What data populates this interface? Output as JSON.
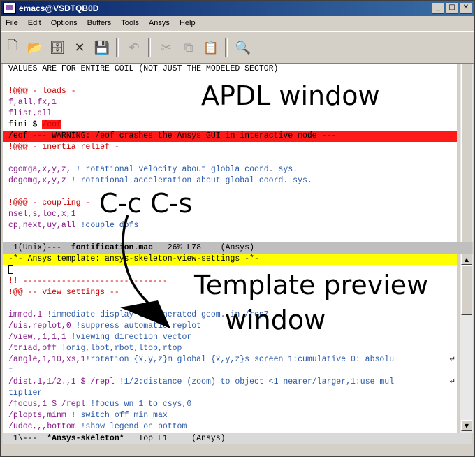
{
  "window": {
    "title": "emacs@VSDTQB0D",
    "buttons": {
      "minimize": "_",
      "maximize": "□",
      "close": "✕"
    }
  },
  "menubar": {
    "items": [
      "File",
      "Edit",
      "Options",
      "Buffers",
      "Tools",
      "Ansys",
      "Help"
    ]
  },
  "toolbar": {
    "buttons": [
      {
        "name": "new-file-icon",
        "glyph": "🗋"
      },
      {
        "name": "open-folder-icon",
        "glyph": "📂"
      },
      {
        "name": "file-cabinet-icon",
        "glyph": "🗄"
      },
      {
        "name": "close-buffer-icon",
        "glyph": "✕"
      },
      {
        "name": "save-icon",
        "glyph": "💾",
        "disabled": true
      },
      {
        "name": "undo-icon",
        "glyph": "↶",
        "disabled": true
      },
      {
        "name": "cut-icon",
        "glyph": "✂",
        "disabled": true
      },
      {
        "name": "copy-icon",
        "glyph": "⧉",
        "disabled": true
      },
      {
        "name": "paste-icon",
        "glyph": "📋"
      },
      {
        "name": "search-icon",
        "glyph": "🔍"
      }
    ]
  },
  "top_window": {
    "lines": [
      {
        "text": "VALUES ARE FOR ENTIRE COIL (NOT JUST THE MODELED SECTOR)",
        "style": "black"
      },
      {
        "text": "",
        "style": "black"
      },
      {
        "text": "!@@@ - loads -",
        "style": "red"
      },
      {
        "text": "f,all,fx,1",
        "style": "purple"
      },
      {
        "text": "flist,all",
        "style": "purple"
      },
      {
        "text_a": "fini $ ",
        "text_b": "/eof",
        "style": "fini"
      },
      {
        "text": "/eof --- WARNING: /eof crashes the Ansys GUI in interactive mode ---",
        "style": "warn"
      },
      {
        "text": "!@@@ - inertia relief -",
        "style": "red"
      },
      {
        "text": "",
        "style": "black"
      },
      {
        "text_a": "cgomga,x,y,z, ",
        "text_b": "! rotational velocity about globla coord. sys.",
        "style": "split"
      },
      {
        "text_a": "dcgomg,x,y,z ",
        "text_b": "! rotational acceleration about global coord. sys.",
        "style": "split"
      },
      {
        "text": "",
        "style": "black"
      },
      {
        "text": "!@@@ - coupling -",
        "style": "red"
      },
      {
        "text": "nsel,s,loc,x,1",
        "style": "purple"
      },
      {
        "text_a": "cp,next,uy,all ",
        "text_b": "!couple dofs",
        "style": "split"
      }
    ],
    "modeline": {
      "prefix": " 1(Unix)---  ",
      "buffer": "fontification.mac",
      "suffix": "   26% L78    (Ansys)"
    }
  },
  "bottom_window": {
    "header": "-*- Ansys template: ansys-skeleton-view-settings -*-",
    "lines": [
      {
        "text": "",
        "style": "cursor"
      },
      {
        "text": "!! ------------------------------",
        "style": "red"
      },
      {
        "text": "!@@ -- view settings --",
        "style": "red"
      },
      {
        "text": "",
        "style": "black"
      },
      {
        "text_a": "immed,1 ",
        "text_b": "!immediate display of generated geom. in /rep7",
        "style": "split"
      },
      {
        "text_a": "/uis,replot,0 ",
        "text_b": "!suppress automatic replot",
        "style": "split"
      },
      {
        "text_a": "/view,,1,1,1 ",
        "text_b": "!viewing direction vector",
        "style": "split"
      },
      {
        "text_a": "/triad,off ",
        "text_b": "!orig,lbot,rbot,ltop,rtop",
        "style": "split"
      },
      {
        "text_a": "/angle,1,10,xs,1",
        "text_b": "!rotation {x,y,z}m global {x,y,z}s screen 1:cumulative 0: absolu",
        "style": "split-wrap"
      },
      {
        "text": "t",
        "style": "blue"
      },
      {
        "text_a": "/dist,1,1/2.,1 $ /repl ",
        "text_b": "!1/2:distance (zoom) to object <1 nearer/larger,1:use mul",
        "style": "split-wrap"
      },
      {
        "text": "tiplier",
        "style": "blue"
      },
      {
        "text_a": "/focus,1 $ /repl ",
        "text_b": "!focus wn 1 to csys,0",
        "style": "split"
      },
      {
        "text_a": "/plopts,minm ",
        "text_b": "! switch off min max",
        "style": "split"
      },
      {
        "text_a": "/udoc,,,bottom ",
        "text_b": "!show legend on bottom",
        "style": "split"
      }
    ],
    "modeline": {
      "prefix": " 1\\---  ",
      "buffer": "*Ansys-skeleton*",
      "suffix": "   Top L1     (Ansys)"
    }
  },
  "annotations": {
    "apdl": "APDL window",
    "keys": "C-c C-s",
    "preview_line1": "Template preview",
    "preview_line2": "window"
  }
}
